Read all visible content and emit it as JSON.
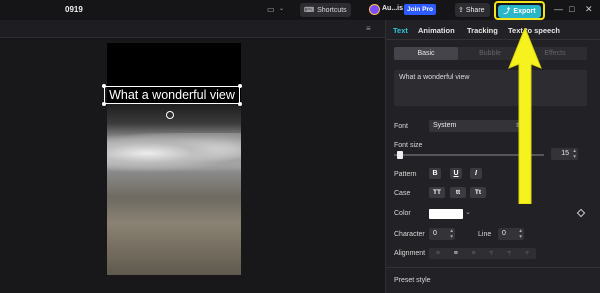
{
  "titlebar": {
    "project_name": "0919",
    "shortcuts_label": "Shortcuts",
    "account_name": "Au...is",
    "join_pro_label": "Join Pro",
    "share_label": "Share",
    "export_label": "Export",
    "icons": [
      "layout-icon",
      "keyboard-icon",
      "share-icon",
      "export-upload-icon",
      "minimize-icon",
      "maximize-icon",
      "close-icon"
    ]
  },
  "canvas": {
    "overlay_text": "What a wonderful view"
  },
  "panel": {
    "tabs": [
      "Text",
      "Animation",
      "Tracking",
      "Text to speech"
    ],
    "active_tab": "Text",
    "subtabs": [
      "Basic",
      "Bubble",
      "Effects"
    ],
    "active_subtab": "Basic",
    "text_value": "What a wonderful view",
    "font_label": "Font",
    "font_value": "System",
    "font_size_label": "Font size",
    "font_size_value": "15",
    "pattern_label": "Pattern",
    "pattern_buttons": [
      "B",
      "U",
      "I"
    ],
    "case_label": "Case",
    "case_buttons": [
      "TT",
      "tt",
      "Tt"
    ],
    "color_label": "Color",
    "color_value": "#ffffff",
    "character_label": "Character",
    "character_value": "0",
    "line_label": "Line",
    "line_value": "0",
    "alignment_label": "Alignment",
    "preset_label": "Preset style"
  },
  "colors": {
    "accent": "#2ec4dc",
    "export_button": "#29b6c8",
    "join_pro": "#2d5bff",
    "highlight": "#f1e31c"
  }
}
